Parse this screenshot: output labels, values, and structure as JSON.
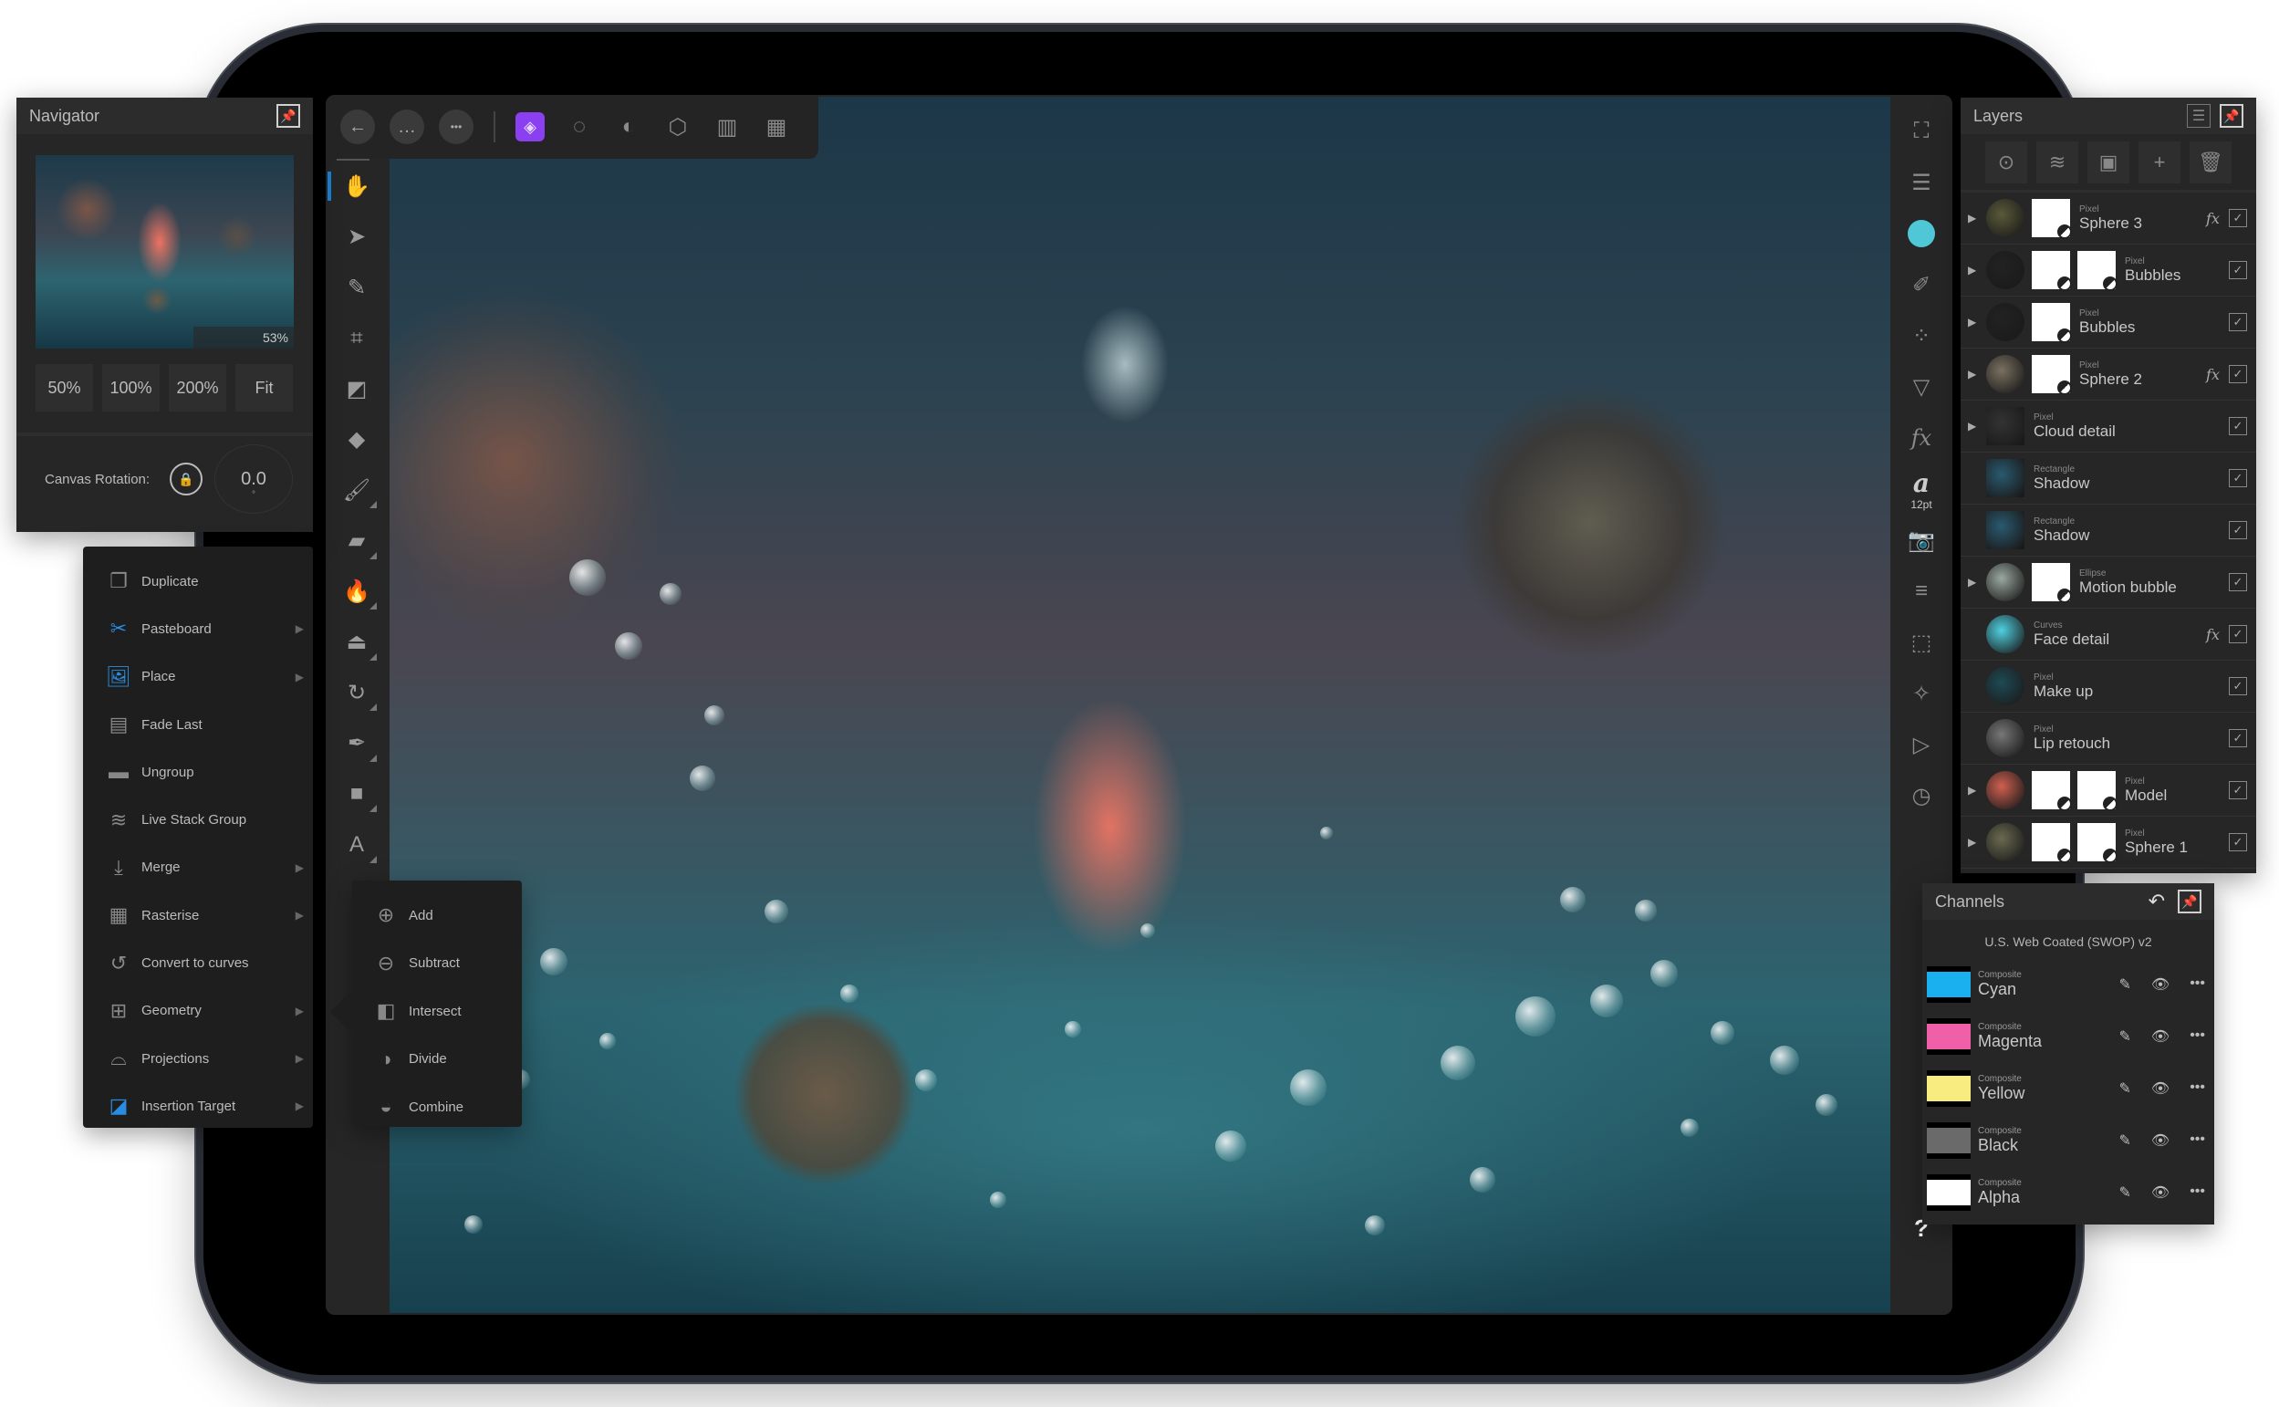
{
  "toolbar": {
    "back_icon": "←",
    "document_icon": "…",
    "more_icon": "•••",
    "personas": [
      {
        "name": "photo-persona",
        "glyph": "◈",
        "active": true
      },
      {
        "name": "liquify-persona",
        "glyph": "◌"
      },
      {
        "name": "develop-persona",
        "glyph": "◐"
      },
      {
        "name": "tone-mapping-persona",
        "glyph": "⬡"
      },
      {
        "name": "export-persona",
        "glyph": "▥"
      },
      {
        "name": "export-alt-persona",
        "glyph": "▦"
      }
    ]
  },
  "left_tools": [
    {
      "name": "hand-tool",
      "glyph": "✋",
      "selected": true
    },
    {
      "name": "move-tool",
      "glyph": "➤"
    },
    {
      "name": "color-picker-tool",
      "glyph": "✎"
    },
    {
      "name": "crop-tool",
      "glyph": "⌗"
    },
    {
      "name": "flood-fill-tool",
      "glyph": "◩"
    },
    {
      "name": "gradient-tool",
      "glyph": "◆"
    },
    {
      "name": "paint-brush-tool",
      "glyph": "🖌"
    },
    {
      "name": "eraser-tool",
      "glyph": "▰"
    },
    {
      "name": "burn-tool",
      "glyph": "🔥"
    },
    {
      "name": "clone-tool",
      "glyph": "⏏"
    },
    {
      "name": "undo-brush-tool",
      "glyph": "↻"
    },
    {
      "name": "pen-tool",
      "glyph": "✒"
    },
    {
      "name": "rectangle-tool",
      "glyph": "■"
    },
    {
      "name": "text-tool",
      "glyph": "A"
    }
  ],
  "right_tools": [
    {
      "name": "fullscreen-icon",
      "glyph": "⛶"
    },
    {
      "name": "layers-studio-icon",
      "glyph": "☰"
    },
    {
      "name": "color-studio-icon",
      "glyph": ""
    },
    {
      "name": "brushes-studio-icon",
      "glyph": "✐"
    },
    {
      "name": "channels-studio-icon",
      "glyph": "⁘"
    },
    {
      "name": "adjustments-studio-icon",
      "glyph": "▽"
    },
    {
      "name": "effects-studio-icon",
      "glyph": "fx"
    },
    {
      "name": "text-styles-studio-icon",
      "glyph": "a",
      "sub": "12pt"
    },
    {
      "name": "snapshots-studio-icon",
      "glyph": "📷"
    },
    {
      "name": "sliders-studio-icon",
      "glyph": "≡"
    },
    {
      "name": "transform-studio-icon",
      "glyph": "⬚"
    },
    {
      "name": "navigator-studio-icon",
      "glyph": "✧"
    },
    {
      "name": "macro-studio-icon",
      "glyph": "▷"
    },
    {
      "name": "history-studio-icon",
      "glyph": "◷"
    }
  ],
  "help_label": "?",
  "navigator": {
    "title": "Navigator",
    "zoom_readout": "53%",
    "zoom_buttons": [
      "50%",
      "100%",
      "200%",
      "Fit"
    ],
    "rotation_label": "Canvas Rotation:",
    "rotation_value": "0.0",
    "rotation_unit": "°"
  },
  "context_menu": {
    "items": [
      {
        "label": "Duplicate",
        "icon": "duplicate-icon",
        "glyph": "❐",
        "submenu": false
      },
      {
        "label": "Pasteboard",
        "icon": "scissors-icon",
        "glyph": "✂",
        "submenu": true
      },
      {
        "label": "Place",
        "icon": "place-image-icon",
        "glyph": "🖼",
        "submenu": true
      },
      {
        "label": "Fade Last",
        "icon": "fade-icon",
        "glyph": "▤",
        "submenu": false
      },
      {
        "label": "Ungroup",
        "icon": "folder-icon",
        "glyph": "▬",
        "submenu": false
      },
      {
        "label": "Live Stack Group",
        "icon": "stack-icon",
        "glyph": "≋",
        "submenu": false
      },
      {
        "label": "Merge",
        "icon": "merge-icon",
        "glyph": "⤓",
        "submenu": true
      },
      {
        "label": "Rasterise",
        "icon": "rasterise-icon",
        "glyph": "▦",
        "submenu": true
      },
      {
        "label": "Convert to curves",
        "icon": "curves-icon",
        "glyph": "↺",
        "submenu": false
      },
      {
        "label": "Geometry",
        "icon": "geometry-icon",
        "glyph": "⊞",
        "submenu": true
      },
      {
        "label": "Projections",
        "icon": "projections-icon",
        "glyph": "⌓",
        "submenu": true
      },
      {
        "label": "Insertion Target",
        "icon": "insertion-target-icon",
        "glyph": "◪",
        "submenu": true
      }
    ]
  },
  "geometry_menu": {
    "items": [
      {
        "label": "Add",
        "glyph": "⊕"
      },
      {
        "label": "Subtract",
        "glyph": "⊖"
      },
      {
        "label": "Intersect",
        "glyph": "◧"
      },
      {
        "label": "Divide",
        "glyph": "◑"
      },
      {
        "label": "Combine",
        "glyph": "◒"
      }
    ]
  },
  "layers": {
    "title": "Layers",
    "tool_buttons": [
      {
        "name": "layer-options-button",
        "glyph": "⊙"
      },
      {
        "name": "add-group-button",
        "glyph": "≋"
      },
      {
        "name": "add-mask-button",
        "glyph": "▣"
      },
      {
        "name": "add-layer-button",
        "glyph": "+"
      },
      {
        "name": "delete-layer-button",
        "glyph": "🗑"
      }
    ],
    "rows": [
      {
        "type": "Pixel",
        "name": "Sphere 3",
        "expand": true,
        "fx": true,
        "masks": 1,
        "thumb": "#5a5a3a",
        "visible": true
      },
      {
        "type": "Pixel",
        "name": "Bubbles",
        "expand": true,
        "fx": false,
        "masks": 2,
        "thumb": "#222",
        "visible": true
      },
      {
        "type": "Pixel",
        "name": "Bubbles",
        "expand": true,
        "fx": false,
        "masks": 1,
        "thumb": "#222",
        "visible": true
      },
      {
        "type": "Pixel",
        "name": "Sphere 2",
        "expand": true,
        "fx": true,
        "masks": 1,
        "thumb": "#7a7060",
        "visible": true
      },
      {
        "type": "Pixel",
        "name": "Cloud detail",
        "expand": true,
        "fx": false,
        "masks": 0,
        "thumb": "#333",
        "visible": true
      },
      {
        "type": "Rectangle",
        "name": "Shadow",
        "expand": false,
        "fx": false,
        "masks": 0,
        "thumb": "#2a5a70",
        "visible": true
      },
      {
        "type": "Rectangle",
        "name": "Shadow",
        "expand": false,
        "fx": false,
        "masks": 0,
        "thumb": "#2a5a70",
        "visible": true
      },
      {
        "type": "Ellipse",
        "name": "Motion bubble",
        "expand": true,
        "fx": false,
        "masks": 1,
        "thumb": "#9aa8a0",
        "visible": true
      },
      {
        "type": "Curves",
        "name": "Face detail",
        "expand": false,
        "fx": true,
        "masks": 0,
        "thumb": "#4fd0e0",
        "visible": true
      },
      {
        "type": "Pixel",
        "name": "Make up",
        "expand": false,
        "fx": false,
        "masks": 0,
        "thumb": "#1e4a55",
        "visible": true
      },
      {
        "type": "Pixel",
        "name": "Lip retouch",
        "expand": false,
        "fx": false,
        "masks": 0,
        "thumb": "#777",
        "visible": true
      },
      {
        "type": "Pixel",
        "name": "Model",
        "expand": true,
        "fx": false,
        "masks": 2,
        "thumb": "#d06050",
        "visible": true
      },
      {
        "type": "Pixel",
        "name": "Sphere 1",
        "expand": true,
        "fx": false,
        "masks": 2,
        "thumb": "#6a6a50",
        "visible": true
      }
    ]
  },
  "channels": {
    "title": "Channels",
    "profile": "U.S. Web Coated (SWOP) v2",
    "rows": [
      {
        "type": "Composite",
        "name": "Cyan",
        "color": "#1ab0f0"
      },
      {
        "type": "Composite",
        "name": "Magenta",
        "color": "#f060a8"
      },
      {
        "type": "Composite",
        "name": "Yellow",
        "color": "#f8ec80"
      },
      {
        "type": "Composite",
        "name": "Black",
        "color": "#6a6a6a"
      },
      {
        "type": "Composite",
        "name": "Alpha",
        "color": "#ffffff"
      }
    ]
  },
  "colors": {
    "accent_blue": "#1a7fd4",
    "persona_purple": "#8a3ff0",
    "current_color": "#4fc7d6",
    "panel_bg": "#262626"
  }
}
